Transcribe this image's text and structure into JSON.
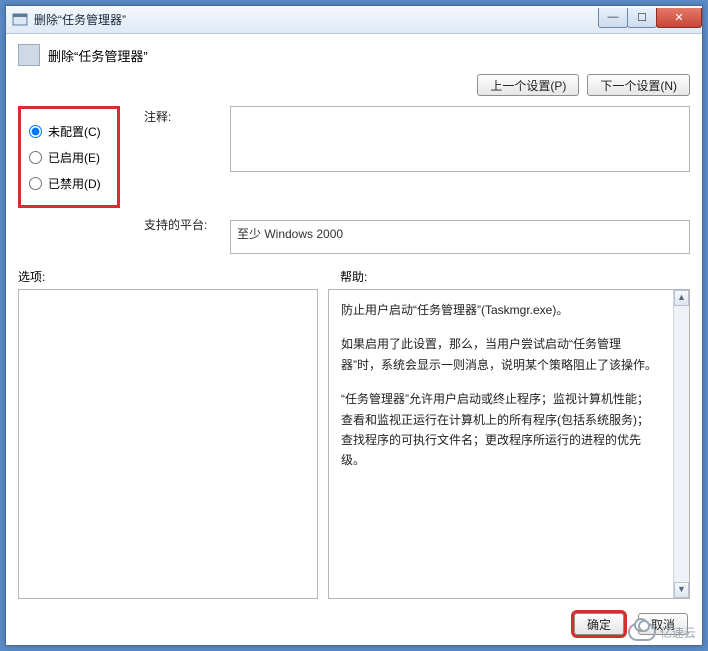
{
  "window": {
    "title": "删除“任务管理器”",
    "minimize_glyph": "—",
    "maximize_glyph": "☐",
    "close_glyph": "✕"
  },
  "header": {
    "title": "删除“任务管理器”"
  },
  "nav": {
    "prev": "上一个设置(P)",
    "next": "下一个设置(N)"
  },
  "radios": {
    "not_configured": "未配置(C)",
    "enabled": "已启用(E)",
    "disabled": "已禁用(D)",
    "selected": "not_configured"
  },
  "labels": {
    "comment": "注释:",
    "platform": "支持的平台:",
    "options": "选项:",
    "help": "帮助:"
  },
  "fields": {
    "comment_value": "",
    "platform_value": "至少 Windows 2000"
  },
  "help_paragraphs": [
    "防止用户启动“任务管理器”(Taskmgr.exe)。",
    "如果启用了此设置，那么，当用户尝试启动“任务管理器”时，系统会显示一则消息，说明某个策略阻止了该操作。",
    "“任务管理器”允许用户启动或终止程序；监视计算机性能；查看和监视正运行在计算机上的所有程序(包括系统服务)；查找程序的可执行文件名；更改程序所运行的进程的优先级。"
  ],
  "footer": {
    "ok": "确定",
    "cancel": "取消"
  },
  "watermark": "亿速云"
}
